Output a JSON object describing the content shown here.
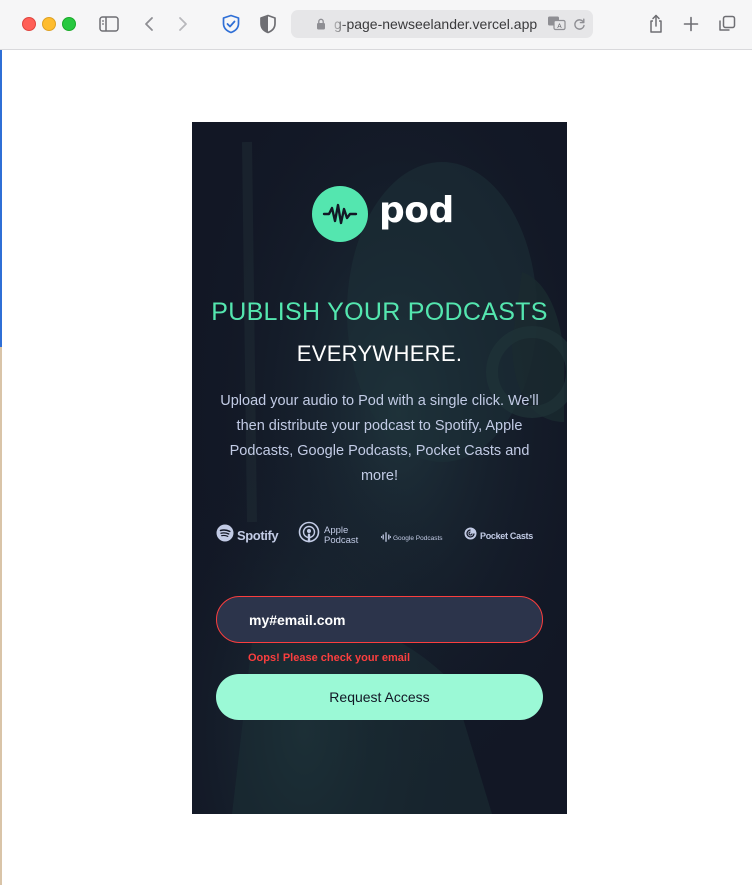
{
  "browser": {
    "url_display": "g-page-newseelander.vercel.app",
    "toolbar_icons": [
      "sidebar-icon",
      "back-icon",
      "forward-icon",
      "shield-check-icon",
      "privacy-shield-icon",
      "lock-icon",
      "translate-icon",
      "reload-icon",
      "share-icon",
      "new-tab-icon",
      "tabs-overview-icon"
    ]
  },
  "page": {
    "logo": {
      "word": "pod",
      "icon": "waveform-icon",
      "color": "#54e6af"
    },
    "headline_line1": "PUBLISH YOUR PODCASTS",
    "headline_line2": "EVERYWHERE.",
    "description": "Upload your audio to Pod with a single click. We'll then distribute your podcast to Spotify, Apple Podcasts, Google Podcasts, Pocket Casts and more!",
    "brands": [
      {
        "name": "Spotify",
        "icon": "spotify-icon"
      },
      {
        "name": "Apple Podcast",
        "icon": "apple-podcast-icon"
      },
      {
        "name": "Google Podcasts",
        "icon": "google-podcasts-icon"
      },
      {
        "name": "Pocket Casts",
        "icon": "pocket-casts-icon"
      }
    ],
    "email_value": "my#email.com",
    "error_message": "Oops! Please check your email",
    "button_label": "Request Access",
    "colors": {
      "background": "#121725",
      "accent": "#54e6af",
      "button": "#9bf9d6",
      "error": "#fb3e3e",
      "input_bg": "#2c344b",
      "body_text": "#c2cbe5"
    }
  }
}
